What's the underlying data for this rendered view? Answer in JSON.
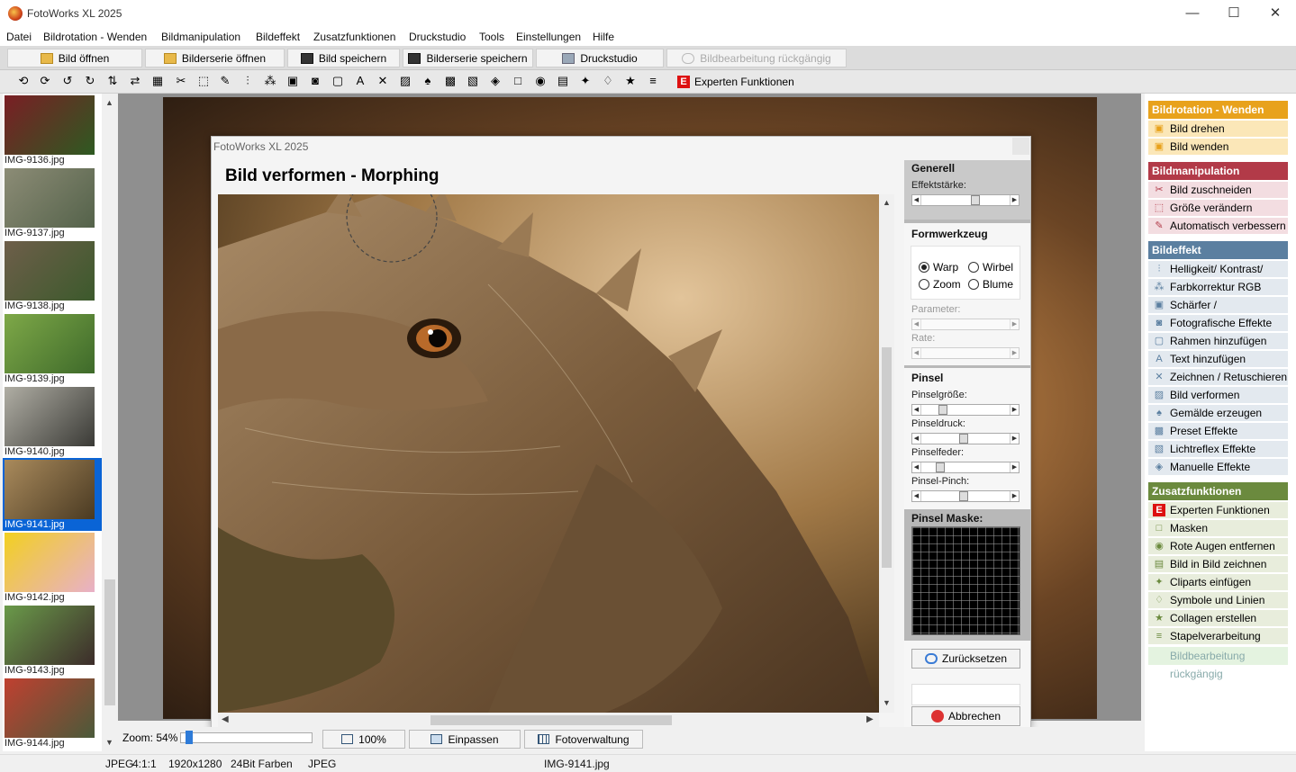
{
  "window": {
    "title": "FotoWorks XL 2025",
    "minimize": "—",
    "maximize": "☐",
    "close": "✕"
  },
  "menu": [
    "Datei",
    "Bildrotation - Wenden",
    "Bildmanipulation",
    "Bildeffekt",
    "Zusatzfunktionen",
    "Druckstudio",
    "Tools",
    "Einstellungen",
    "Hilfe"
  ],
  "toolbar": {
    "open": "Bild öffnen",
    "open_series": "Bilderserie öffnen",
    "save": "Bild speichern",
    "save_series": "Bilderserie speichern",
    "print": "Druckstudio",
    "undo": "Bildbearbeitung rückgängig"
  },
  "toolbar2": {
    "icons": [
      "rotate-left-icon",
      "rotate-right-icon",
      "rotate-ccw-icon",
      "rotate-cw-icon",
      "flip-icon",
      "mirror-icon",
      "batch-icon",
      "crop-icon",
      "resize-icon",
      "auto-enhance-icon",
      "brightness-icon",
      "rgb-icon",
      "sharpen-icon",
      "photo-effects-icon",
      "frame-icon",
      "text-icon",
      "draw-icon",
      "morph-icon",
      "painting-icon",
      "preset-icon",
      "lightflex-icon",
      "manual-icon",
      "mask-icon",
      "redeye-icon",
      "pip-icon",
      "clipart-icon",
      "symbols-icon",
      "collage-icon",
      "batch-process-icon"
    ],
    "glyphs": [
      "⟲",
      "⟳",
      "↺",
      "↻",
      "⇅",
      "⇄",
      "▦",
      "✂",
      "⬚",
      "✎",
      "⫶",
      "⁂",
      "▣",
      "◙",
      "▢",
      "A",
      "✕",
      "▨",
      "♠",
      "▩",
      "▧",
      "◈",
      "□",
      "◉",
      "▤",
      "✦",
      "♢",
      "★",
      "≡"
    ],
    "experts": "Experten Funktionen",
    "experts_badge": "E"
  },
  "thumbnails": [
    {
      "name": "IMG-9136.jpg",
      "color1": "#7a1e24",
      "color2": "#2e5a22"
    },
    {
      "name": "IMG-9137.jpg",
      "color1": "#8c8c76",
      "color2": "#54624a"
    },
    {
      "name": "IMG-9138.jpg",
      "color1": "#6e5e4a",
      "color2": "#3c5a2c"
    },
    {
      "name": "IMG-9139.jpg",
      "color1": "#7ea848",
      "color2": "#3e6a2a"
    },
    {
      "name": "IMG-9140.jpg",
      "color1": "#b0aea4",
      "color2": "#3a3a36"
    },
    {
      "name": "IMG-9141.jpg",
      "color1": "#a98a5c",
      "color2": "#4a3a22"
    },
    {
      "name": "IMG-9142.jpg",
      "color1": "#f2d020",
      "color2": "#e8b0c8"
    },
    {
      "name": "IMG-9143.jpg",
      "color1": "#6a9a4a",
      "color2": "#3c2c2a"
    },
    {
      "name": "IMG-9144.jpg",
      "color1": "#c04030",
      "color2": "#4a5a3a"
    }
  ],
  "dialog": {
    "title": "FotoWorks XL 2025",
    "close": "✕",
    "heading": "Bild verformen - Morphing",
    "generell": {
      "title": "Generell",
      "label": "Effektstärke:",
      "value": 0.62
    },
    "formwerkzeug": {
      "title": "Formwerkzeug",
      "options": [
        "Warp",
        "Wirbel",
        "Zoom",
        "Blume"
      ],
      "selected": "Warp",
      "parameter": "Parameter:",
      "rate": "Rate:"
    },
    "pinsel": {
      "title": "Pinsel",
      "size": "Pinselgröße:",
      "size_value": 0.22,
      "pressure": "Pinseldruck:",
      "pressure_value": 0.48,
      "feather": "Pinselfeder:",
      "feather_value": 0.18,
      "pinch": "Pinsel-Pinch:",
      "pinch_value": 0.48
    },
    "mask_title": "Pinsel Maske:",
    "reset": "Zurücksetzen",
    "cancel": "Abbrechen"
  },
  "right_panel": {
    "sections": [
      {
        "title": "Bildrotation - Wenden",
        "color": "#e8a21c",
        "item_bg": "#fbe7b8",
        "items": [
          {
            "label": "Bild drehen",
            "icon": "rotate-icon",
            "glyph": "▣"
          },
          {
            "label": "Bild wenden",
            "icon": "flip-icon",
            "glyph": "▣"
          }
        ]
      },
      {
        "title": "Bildmanipulation",
        "color": "#b23a48",
        "item_bg": "#f3dde1",
        "items": [
          {
            "label": "Bild zuschneiden",
            "icon": "crop-icon",
            "glyph": "✂"
          },
          {
            "label": "Größe verändern",
            "icon": "resize-icon",
            "glyph": "⬚"
          },
          {
            "label": "Automatisch verbessern",
            "icon": "auto-enhance-icon",
            "glyph": "✎"
          }
        ]
      },
      {
        "title": "Bildeffekt",
        "color": "#5b7fa0",
        "item_bg": "#e3e9ef",
        "items": [
          {
            "label": "Helligkeit/ Kontrast/ Farbe",
            "icon": "brightness-icon",
            "glyph": "⫶"
          },
          {
            "label": "Farbkorrektur RGB",
            "icon": "rgb-icon",
            "glyph": "⁂"
          },
          {
            "label": "Schärfer / Weichzeichner",
            "icon": "sharpen-icon",
            "glyph": "▣"
          },
          {
            "label": "Fotografische Effekte",
            "icon": "photo-effects-icon",
            "glyph": "◙"
          },
          {
            "label": "Rahmen hinzufügen",
            "icon": "frame-icon",
            "glyph": "▢"
          },
          {
            "label": "Text hinzufügen",
            "icon": "text-icon",
            "glyph": "A"
          },
          {
            "label": "Zeichnen / Retuschieren",
            "icon": "draw-icon",
            "glyph": "✕"
          },
          {
            "label": "Bild verformen (Morphing)",
            "icon": "morph-icon",
            "glyph": "▨"
          },
          {
            "label": "Gemälde erzeugen",
            "icon": "painting-icon",
            "glyph": "♠"
          },
          {
            "label": "Preset Effekte",
            "icon": "preset-icon",
            "glyph": "▩"
          },
          {
            "label": "Lichtreflex Effekte",
            "icon": "lightflex-icon",
            "glyph": "▧"
          },
          {
            "label": "Manuelle Effekte",
            "icon": "manual-icon",
            "glyph": "◈"
          }
        ]
      },
      {
        "title": "Zusatzfunktionen",
        "color": "#6b8a3e",
        "item_bg": "#e8eddc",
        "items": [
          {
            "label": "Experten Funktionen",
            "icon": "experts-icon",
            "glyph": "E"
          },
          {
            "label": "Masken",
            "icon": "mask-icon",
            "glyph": "□"
          },
          {
            "label": "Rote Augen entfernen",
            "icon": "redeye-icon",
            "glyph": "◉"
          },
          {
            "label": "Bild in Bild zeichnen",
            "icon": "pip-icon",
            "glyph": "▤"
          },
          {
            "label": "Cliparts einfügen",
            "icon": "clipart-icon",
            "glyph": "✦"
          },
          {
            "label": "Symbole und Linien",
            "icon": "symbols-icon",
            "glyph": "♢"
          },
          {
            "label": "Collagen erstellen",
            "icon": "collage-icon",
            "glyph": "★"
          },
          {
            "label": "Stapelverarbeitung",
            "icon": "batch-icon",
            "glyph": "≡"
          }
        ]
      }
    ],
    "undo": "Bildbearbeitung rückgängig"
  },
  "bottom": {
    "zoom_label": "Zoom: 54%",
    "zoom_value": 0.54,
    "btn_100": "100%",
    "btn_fit": "Einpassen",
    "btn_manager": "Fotoverwaltung"
  },
  "status": {
    "format": "JPEG",
    "ratio": "4:1:1",
    "size": "1920x1280",
    "colors": "24Bit Farben",
    "type": "JPEG",
    "file": "IMG-9141.jpg"
  }
}
